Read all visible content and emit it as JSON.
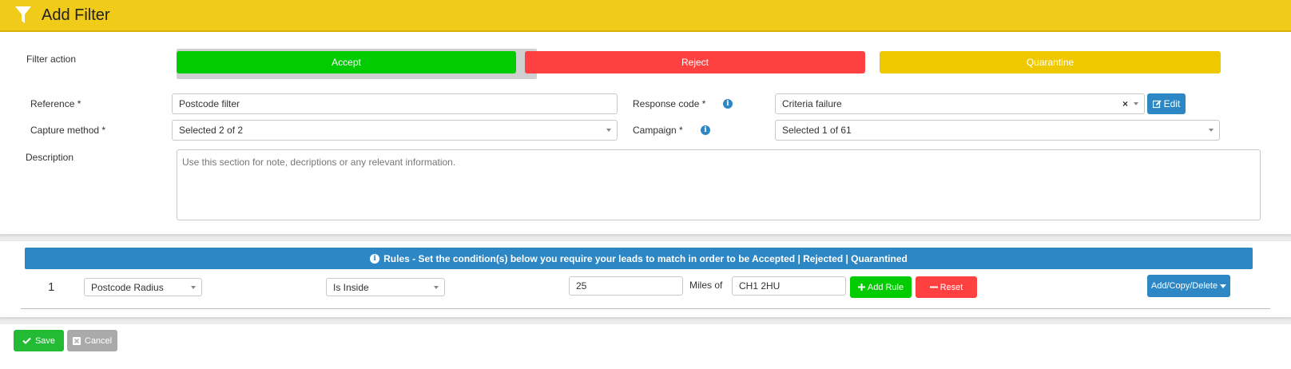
{
  "header": {
    "title": "Add Filter",
    "icon": "filter-icon"
  },
  "filter_action": {
    "label": "Filter action",
    "options": [
      {
        "label": "Accept",
        "color": "#00cc00",
        "selected": true
      },
      {
        "label": "Reject",
        "color": "#ff4040",
        "selected": false
      },
      {
        "label": "Quarantine",
        "color": "#efc900",
        "selected": false
      }
    ]
  },
  "form": {
    "reference": {
      "label": "Reference *",
      "value": "Postcode filter"
    },
    "response_code": {
      "label": "Response code *",
      "value": "Criteria failure",
      "clear": "×",
      "edit_label": "Edit"
    },
    "capture_method": {
      "label": "Capture method *",
      "value": "Selected 2 of 2"
    },
    "campaign": {
      "label": "Campaign *",
      "value": "Selected 1 of 61"
    },
    "description": {
      "label": "Description",
      "placeholder": "Use this section for note, decriptions or any relevant information."
    }
  },
  "rules": {
    "banner": "Rules - Set the condition(s) below you require your leads to match in order to be Accepted | Rejected | Quarantined",
    "rows": [
      {
        "index": "1",
        "field": "Postcode Radius",
        "operator": "Is Inside",
        "value": "25",
        "unit_label": "Miles of",
        "postcode": "CH1 2HU",
        "add_rule_label": "Add Rule",
        "reset_label": "Reset",
        "menu_label": "Add/Copy/Delete"
      }
    ]
  },
  "footer": {
    "save_label": "Save",
    "cancel_label": "Cancel"
  },
  "colors": {
    "header": "#f0cb1a",
    "primary": "#2d87c5",
    "success": "#00cc00",
    "danger": "#ff4040"
  }
}
